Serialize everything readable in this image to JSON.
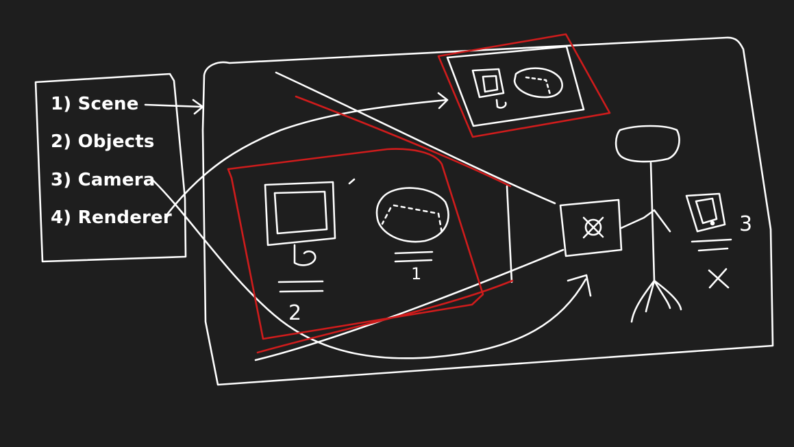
{
  "colors": {
    "background": "#1e1e1e",
    "stroke": "#ffffff",
    "highlight": "#d01c1c"
  },
  "steps": {
    "scene": "1) Scene",
    "objects": "2) Objects",
    "camera": "3) Camera",
    "renderer": "4) Renderer"
  },
  "sketch_labels": {
    "computer_number": "2",
    "mesh_number": "1",
    "mini_computer_number": "3"
  },
  "icons": {
    "computer": "computer-icon",
    "mesh": "mesh-icon",
    "camera": "camera-icon",
    "person": "stick-figure-icon"
  }
}
